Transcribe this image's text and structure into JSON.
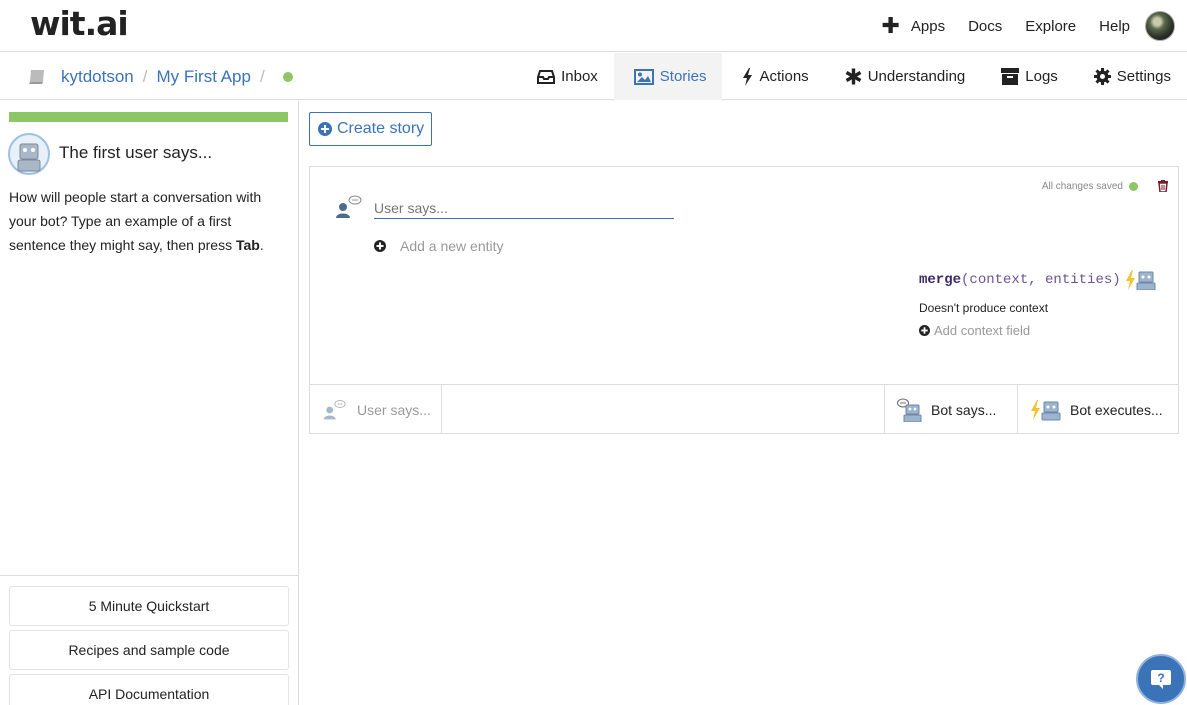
{
  "header": {
    "logo": "wit.ai",
    "nav": {
      "plus": "✚",
      "apps": "Apps",
      "docs": "Docs",
      "explore": "Explore",
      "help": "Help"
    }
  },
  "breadcrumb": {
    "user": "kytdotson",
    "separator": "/",
    "app": "My First App"
  },
  "tabs": [
    {
      "label": "Inbox",
      "icon": "inbox-icon",
      "active": false
    },
    {
      "label": "Stories",
      "icon": "image-icon",
      "active": true
    },
    {
      "label": "Actions",
      "icon": "bolt-icon",
      "active": false
    },
    {
      "label": "Understanding",
      "icon": "asterisk-icon",
      "active": false
    },
    {
      "label": "Logs",
      "icon": "archive-icon",
      "active": false
    },
    {
      "label": "Settings",
      "icon": "gear-icon",
      "active": false
    }
  ],
  "left_panel": {
    "progress": 1.0,
    "title": "The first user says...",
    "text_before": "How will people start a conversation with your bot? Type an example of a first sentence they might say, then press ",
    "text_key": "Tab",
    "text_after": ".",
    "links": [
      "5 Minute Quickstart",
      "Recipes and sample code",
      "API Documentation"
    ]
  },
  "main": {
    "create_story": "Create story",
    "story": {
      "saved_status": "All changes saved",
      "user_says_placeholder": "User says...",
      "add_entity": "Add a new entity",
      "merge_fn": "merge",
      "merge_args": "(context, entities)",
      "no_context": "Doesn't produce context",
      "add_context": "Add context field"
    },
    "footer": {
      "user_says": "User says...",
      "bot_says": "Bot says...",
      "bot_executes": "Bot executes..."
    }
  },
  "colors": {
    "accent": "#3b73b9",
    "success": "#8cc665",
    "bolt": "#f2c230"
  }
}
